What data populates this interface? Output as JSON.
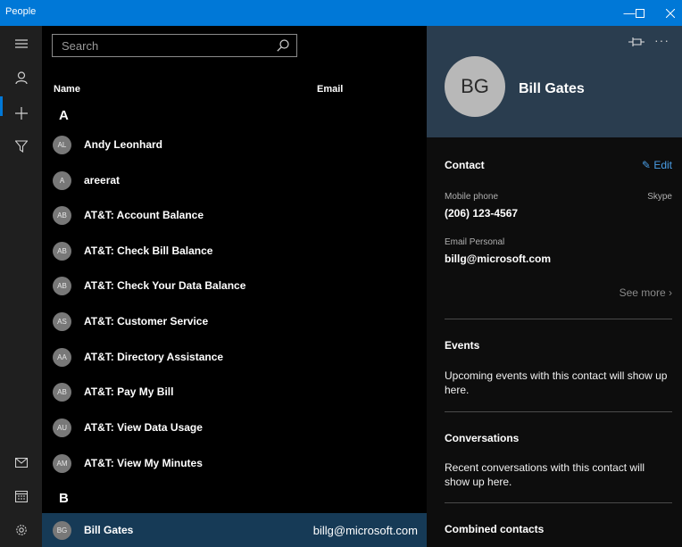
{
  "window": {
    "title": "People",
    "minimize_icon": "minimize-icon",
    "maximize_icon": "maximize-icon",
    "close_icon": "close-icon",
    "accent": "#0078d7"
  },
  "rail": {
    "items": [
      {
        "name": "hamburger-menu-icon"
      },
      {
        "name": "person-icon"
      },
      {
        "name": "add-icon"
      },
      {
        "name": "filter-icon"
      },
      {
        "name": "mail-icon"
      },
      {
        "name": "calendar-icon"
      },
      {
        "name": "settings-icon"
      }
    ]
  },
  "list": {
    "search_placeholder": "Search",
    "header_name": "Name",
    "header_email": "Email",
    "group_a": "A",
    "group_b": "B",
    "contacts": [
      {
        "initials": "AL",
        "name": "Andy Leonhard",
        "email": ""
      },
      {
        "initials": "A",
        "name": "areerat",
        "email": ""
      },
      {
        "initials": "AB",
        "name": "AT&T: Account Balance",
        "email": ""
      },
      {
        "initials": "AB",
        "name": "AT&T: Check Bill Balance",
        "email": ""
      },
      {
        "initials": "AB",
        "name": "AT&T: Check Your Data Balance",
        "email": ""
      },
      {
        "initials": "AS",
        "name": "AT&T: Customer Service",
        "email": ""
      },
      {
        "initials": "AA",
        "name": "AT&T: Directory Assistance",
        "email": ""
      },
      {
        "initials": "AB",
        "name": "AT&T: Pay My Bill",
        "email": ""
      },
      {
        "initials": "AU",
        "name": "AT&T: View Data Usage",
        "email": ""
      },
      {
        "initials": "AM",
        "name": "AT&T: View My Minutes",
        "email": ""
      },
      {
        "initials": "BG",
        "name": "Bill Gates",
        "email": "billg@microsoft.com",
        "selected": true
      }
    ]
  },
  "detail": {
    "initials": "BG",
    "name": "Bill Gates",
    "contact_title": "Contact",
    "edit_label": "Edit",
    "mobile_label": "Mobile phone",
    "skype_label": "Skype",
    "mobile_value": "(206) 123-4567",
    "email_label": "Email Personal",
    "email_value": "billg@microsoft.com",
    "see_more": "See more",
    "events_title": "Events",
    "events_text": "Upcoming events with this contact will show up here.",
    "conversations_title": "Conversations",
    "conversations_text": "Recent conversations with this contact will show up here.",
    "combined_title": "Combined contacts"
  }
}
